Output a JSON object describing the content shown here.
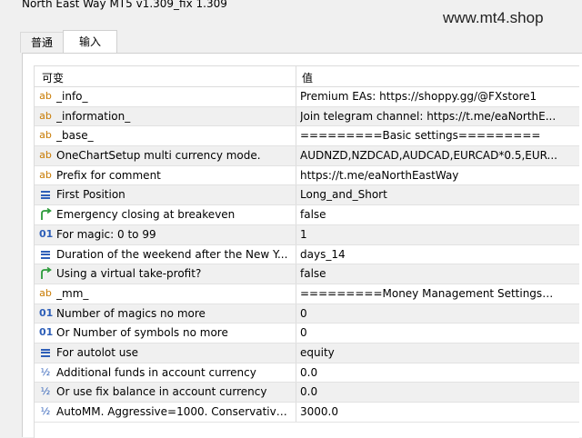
{
  "window": {
    "title": "North East Way MT5 v1.309_fix 1.309",
    "watermark": "www.mt4.shop"
  },
  "tabs": [
    {
      "label": "普通"
    },
    {
      "label": "输入"
    }
  ],
  "table": {
    "col_variable": "可变",
    "col_value": "值",
    "rows": [
      {
        "icon": "ab-string-icon",
        "name": "_info_",
        "value": "Premium EAs: https://shoppy.gg/@FXstore1"
      },
      {
        "icon": "ab-string-icon",
        "name": "_information_",
        "value": "Join telegram channel: https://t.me/eaNorthE..."
      },
      {
        "icon": "ab-string-icon",
        "name": "_base_",
        "value": "=========Basic settings========="
      },
      {
        "icon": "ab-string-icon",
        "name": "OneChartSetup multi currency mode.",
        "value": "AUDNZD,NZDCAD,AUDCAD,EURCAD*0.5,EUR..."
      },
      {
        "icon": "ab-string-icon",
        "name": "Prefix for comment",
        "value": "https://t.me/eaNorthEastWay"
      },
      {
        "icon": "enum-list-icon",
        "name": "First Position",
        "value": "Long_and_Short"
      },
      {
        "icon": "bool-arrow-icon",
        "name": "Emergency closing at breakeven",
        "value": "false"
      },
      {
        "icon": "int-01-icon",
        "name": "For magic: 0 to 99",
        "value": "1"
      },
      {
        "icon": "enum-list-icon",
        "name": "Duration of the weekend after the New Y...",
        "value": "days_14"
      },
      {
        "icon": "bool-arrow-icon",
        "name": "Using a virtual take-profit?",
        "value": "false"
      },
      {
        "icon": "ab-string-icon",
        "name": "_mm_",
        "value": "=========Money Management Settings=..."
      },
      {
        "icon": "int-01-icon",
        "name": "Number of magics no more",
        "value": "0"
      },
      {
        "icon": "int-01-icon",
        "name": "Or Number of symbols no more",
        "value": "0"
      },
      {
        "icon": "enum-list-icon",
        "name": "For autolot use",
        "value": "equity"
      },
      {
        "icon": "half-double-icon",
        "name": "Additional funds in account currency",
        "value": "0.0"
      },
      {
        "icon": "half-double-icon",
        "name": "Or use fix balance in account currency",
        "value": "0.0"
      },
      {
        "icon": "half-double-icon",
        "name": "AutoMM. Aggressive=1000. Conservative...",
        "value": "3000.0"
      }
    ]
  }
}
